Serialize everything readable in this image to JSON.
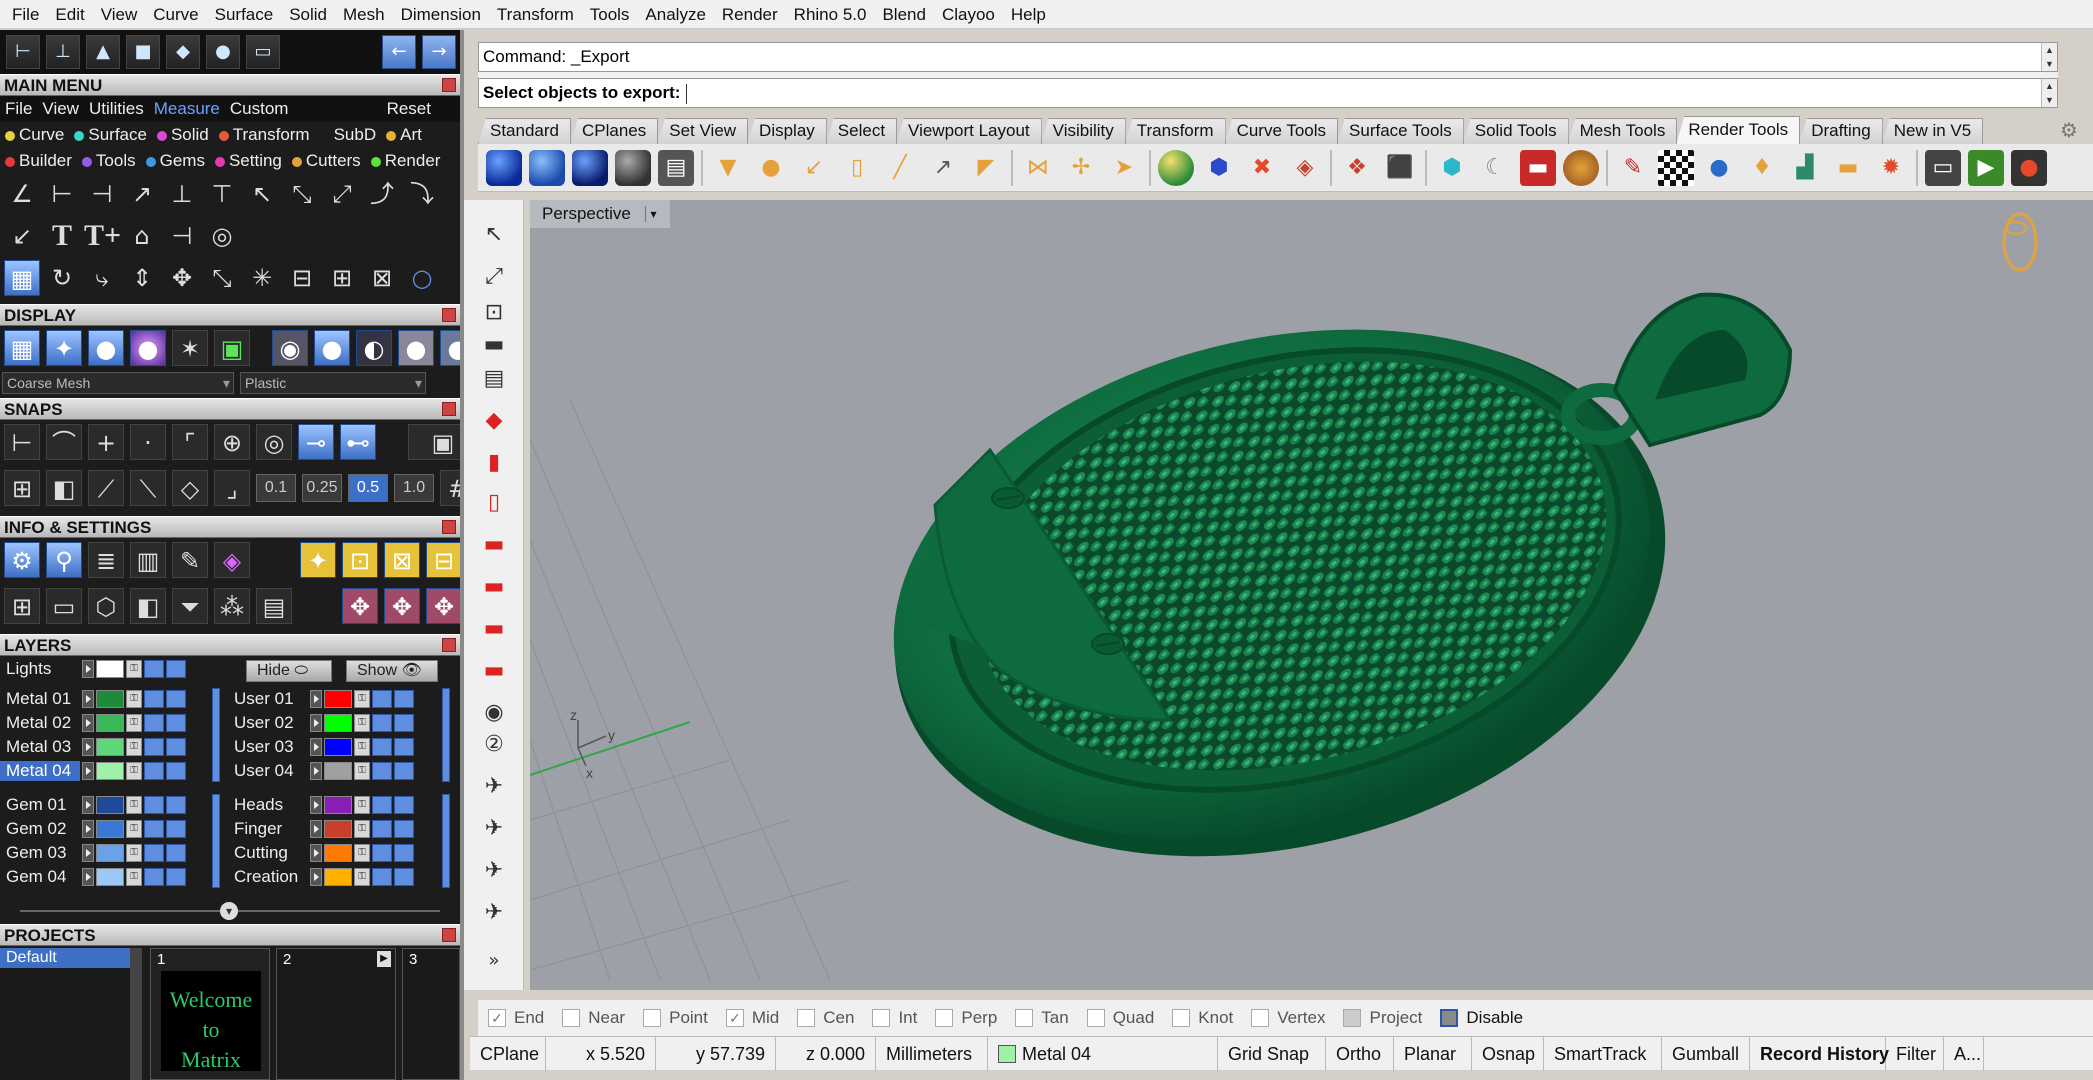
{
  "menubar": [
    "File",
    "Edit",
    "View",
    "Curve",
    "Surface",
    "Solid",
    "Mesh",
    "Dimension",
    "Transform",
    "Tools",
    "Analyze",
    "Render",
    "Rhino 5.0",
    "Blend",
    "Clayoo",
    "Help"
  ],
  "left": {
    "main_menu_title": "MAIN MENU",
    "main_menu_row1": [
      "File",
      "View",
      "Utilities",
      "Measure",
      "Custom"
    ],
    "main_menu_reset": "Reset",
    "main_menu_row2": [
      {
        "label": "Curve",
        "color": "#e6d23a"
      },
      {
        "label": "Surface",
        "color": "#3ad6c8"
      },
      {
        "label": "Solid",
        "color": "#d94ad9"
      },
      {
        "label": "Transform",
        "color": "#e65a3a"
      },
      {
        "label": "SubD",
        "color": "#1c1c1c"
      },
      {
        "label": "Art",
        "color": "#e6b23a"
      }
    ],
    "main_menu_row3": [
      {
        "label": "Builder",
        "color": "#e63a3a"
      },
      {
        "label": "Tools",
        "color": "#9a5ae6"
      },
      {
        "label": "Gems",
        "color": "#3a9ae6"
      },
      {
        "label": "Setting",
        "color": "#e63ab2"
      },
      {
        "label": "Cutters",
        "color": "#e6a23a"
      },
      {
        "label": "Render",
        "color": "#5ae63a"
      }
    ],
    "display_title": "DISPLAY",
    "display_combo1": "Coarse Mesh",
    "display_combo2": "Plastic",
    "snaps_title": "SNAPS",
    "snap_values": [
      "0.1",
      "0.25",
      "0.5",
      "1.0"
    ],
    "info_title": "INFO & SETTINGS",
    "layers_title": "LAYERS",
    "lights_label": "Lights",
    "hide_label": "Hide",
    "show_label": "Show",
    "layers_left": [
      {
        "name": "Metal 01",
        "color": "#1f8a3a"
      },
      {
        "name": "Metal 02",
        "color": "#3ab85a"
      },
      {
        "name": "Metal 03",
        "color": "#5ed67a"
      },
      {
        "name": "Metal 04",
        "color": "#9ff0a8",
        "selected": true
      },
      {
        "name": "Gem 01",
        "color": "#1f4a9a"
      },
      {
        "name": "Gem 02",
        "color": "#3a78d6"
      },
      {
        "name": "Gem 03",
        "color": "#6aa2e8"
      },
      {
        "name": "Gem 04",
        "color": "#9cc8f5"
      }
    ],
    "layers_right": [
      {
        "name": "User 01",
        "color": "#ff0000"
      },
      {
        "name": "User 02",
        "color": "#00ff00"
      },
      {
        "name": "User 03",
        "color": "#0000ff"
      },
      {
        "name": "User 04",
        "color": "#a0a0a0"
      },
      {
        "name": "Heads",
        "color": "#8a1fb8"
      },
      {
        "name": "Finger",
        "color": "#c8402a"
      },
      {
        "name": "Cutting",
        "color": "#ff7a00"
      },
      {
        "name": "Creation",
        "color": "#ffb000"
      }
    ],
    "projects_title": "PROJECTS",
    "project_default": "Default",
    "project_slots": [
      "1",
      "2",
      "3"
    ],
    "welcome_text": [
      "Welcome to",
      "Matrix"
    ]
  },
  "command": {
    "line1": "Command: _Export",
    "line2": "Select objects to export:"
  },
  "tabs": [
    "Standard",
    "CPlanes",
    "Set View",
    "Display",
    "Select",
    "Viewport Layout",
    "Visibility",
    "Transform",
    "Curve Tools",
    "Surface Tools",
    "Solid Tools",
    "Mesh Tools",
    "Render Tools",
    "Drafting",
    "New in V5"
  ],
  "active_tab": "Render Tools",
  "viewport": {
    "title": "Perspective",
    "axis_x": "x",
    "axis_y": "y",
    "axis_z": "z"
  },
  "osnaps": [
    {
      "label": "End",
      "checked": true
    },
    {
      "label": "Near",
      "checked": false
    },
    {
      "label": "Point",
      "checked": false
    },
    {
      "label": "Mid",
      "checked": true
    },
    {
      "label": "Cen",
      "checked": false
    },
    {
      "label": "Int",
      "checked": false
    },
    {
      "label": "Perp",
      "checked": false
    },
    {
      "label": "Tan",
      "checked": false
    },
    {
      "label": "Quad",
      "checked": false
    },
    {
      "label": "Knot",
      "checked": false
    },
    {
      "label": "Vertex",
      "checked": false
    },
    {
      "label": "Project",
      "checked": false
    },
    {
      "label": "Disable",
      "checked": false
    }
  ],
  "status": {
    "cplane": "CPlane",
    "x": "x 5.520",
    "y": "y 57.739",
    "z": "z 0.000",
    "units": "Millimeters",
    "layer": "Metal 04",
    "layer_color": "#9ff0a8",
    "toggles": [
      "Grid Snap",
      "Ortho",
      "Planar",
      "Osnap",
      "SmartTrack",
      "Gumball",
      "Record History",
      "Filter",
      "A..."
    ]
  },
  "colors": {
    "model_green": "#0e6b3f",
    "viewport_bg": "#9da1a7",
    "accent_blue": "#3d6fc7"
  }
}
